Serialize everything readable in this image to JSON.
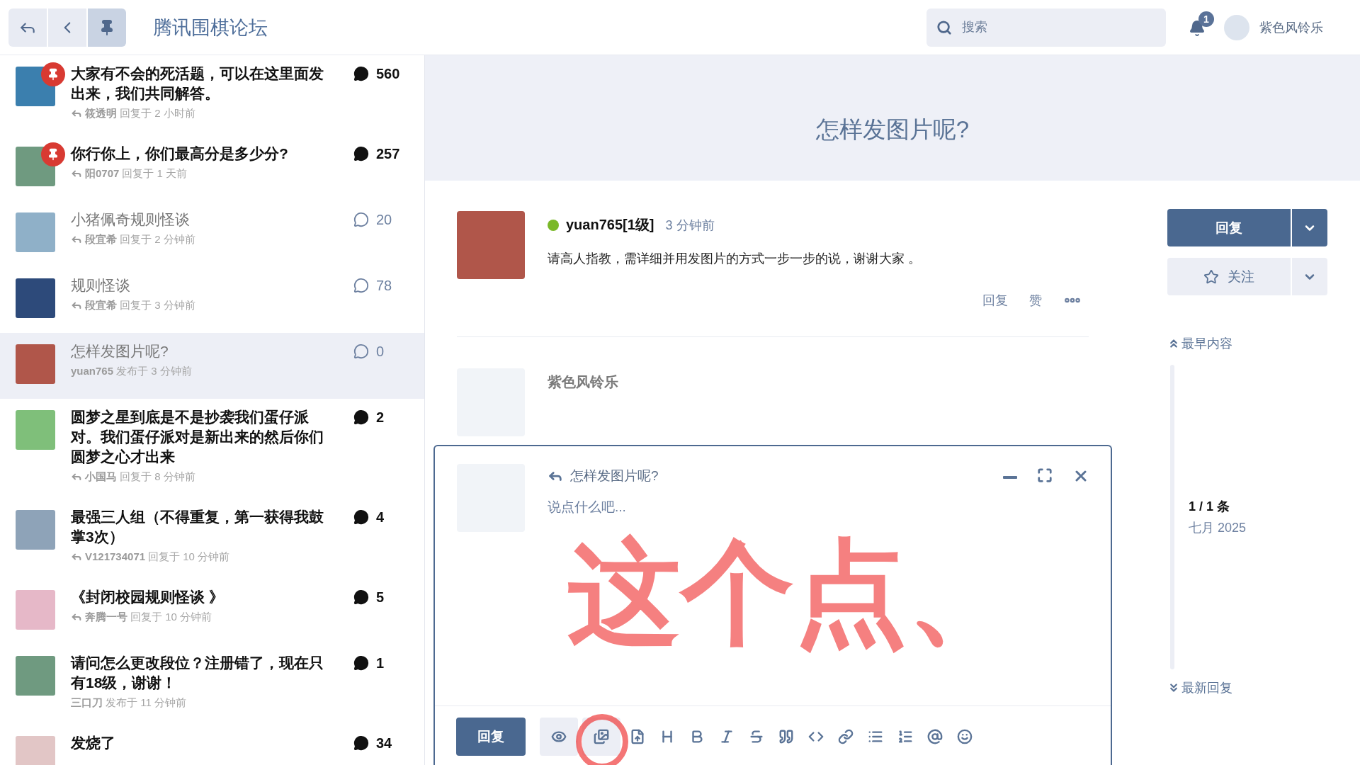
{
  "header": {
    "nav_buttons": [
      {
        "kind": "reply",
        "selected": false
      },
      {
        "kind": "back",
        "selected": false
      },
      {
        "kind": "pin",
        "selected": true
      }
    ],
    "forum_title": "腾讯围棋论坛",
    "search": {
      "placeholder": "搜索"
    },
    "notification_count": "1",
    "username": "紫色风铃乐"
  },
  "discussions": [
    {
      "title": "大家有不会的死活题，可以在这里面发出来，我们共同解答。",
      "pinned": true,
      "unread": true,
      "kind": "reply",
      "author": "筱透明",
      "meta": "回复于 2 小时前",
      "count": "560",
      "selected": false
    },
    {
      "title": "你行你上，你们最高分是多少分?",
      "pinned": true,
      "unread": true,
      "kind": "reply",
      "author": "阳0707",
      "meta": "回复于 1 天前",
      "count": "257",
      "selected": false
    },
    {
      "title": "小猪佩奇规则怪谈",
      "pinned": false,
      "unread": false,
      "kind": "reply",
      "author": "段宜希",
      "meta": "回复于 2 分钟前",
      "count": "20",
      "selected": false
    },
    {
      "title": "规则怪谈",
      "pinned": false,
      "unread": false,
      "kind": "reply",
      "author": "段宜希",
      "meta": "回复于 3 分钟前",
      "count": "78",
      "selected": false
    },
    {
      "title": "怎样发图片呢?",
      "pinned": false,
      "unread": false,
      "kind": "post",
      "author": "yuan765",
      "meta": "发布于 3 分钟前",
      "count": "0",
      "selected": true
    },
    {
      "title": "圆梦之星到底是不是抄袭我们蛋仔派对。我们蛋仔派对是新出来的然后你们圆梦之心才出来",
      "pinned": false,
      "unread": true,
      "kind": "reply",
      "author": "小国马",
      "meta": "回复于 8 分钟前",
      "count": "2",
      "selected": false
    },
    {
      "title": "最强三人组（不得重复，第一获得我鼓掌3次）",
      "pinned": false,
      "unread": true,
      "kind": "reply",
      "author": "V121734071",
      "meta": "回复于 10 分钟前",
      "count": "4",
      "selected": false
    },
    {
      "title": "《封闭校园规则怪谈 》",
      "pinned": false,
      "unread": true,
      "kind": "reply",
      "author": "奔腾一号",
      "meta": "回复于 10 分钟前",
      "count": "5",
      "selected": false
    },
    {
      "title": "请问怎么更改段位？注册错了，现在只有18级，谢谢！",
      "pinned": false,
      "unread": true,
      "kind": "post",
      "author": "三口刀",
      "meta": "发布于 11 分钟前",
      "count": "1",
      "selected": false
    },
    {
      "title": "发烧了",
      "pinned": false,
      "unread": true,
      "kind": "none",
      "count": "34",
      "selected": false
    }
  ],
  "discussion": {
    "title": "怎样发图片呢?",
    "post": {
      "author": "yuan765[1级]",
      "online": true,
      "time": "3 分钟前",
      "body": "请高人指教，需详细并用发图片的方式一步一步的说，谢谢大家  。",
      "actions": [
        "回复",
        "赞"
      ]
    },
    "typing_user": "紫色风铃乐"
  },
  "composer": {
    "title": "怎样发图片呢?",
    "placeholder": "说点什么吧...",
    "submit": "回复"
  },
  "sidebar": {
    "reply": "回复",
    "follow": "关注",
    "earliest": "最早内容",
    "position": "1 / 1 条",
    "date": "七月 2025",
    "latest": "最新回复"
  },
  "annotation": {
    "text": "这个点、"
  }
}
